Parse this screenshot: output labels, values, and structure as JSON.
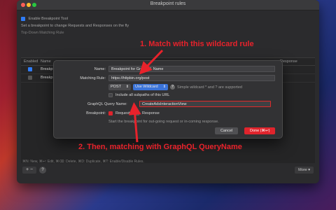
{
  "window": {
    "title": "Breakpoint rules"
  },
  "background": {
    "enable_label": "Enable Breakpoint Tool",
    "description": "Set a breakpoint to change Requests and Responses on the fly",
    "section_label": "Top-Down Matching Rule",
    "columns": {
      "enabled": "Enabled",
      "name": "Name",
      "response": "Response"
    },
    "rows": [
      "Breakp",
      "Breakp"
    ],
    "footer_hint": "⌘N: New, ⌘↩: Edit, ⌘⌫: Delete, ⌘D: Duplicate, ⌘T: Enable/Disable Rules.",
    "more_label": "More"
  },
  "sheet": {
    "name_label": "Name:",
    "name_value": "Breakpoint for GraphQL Name",
    "matching_rule_label": "Matching Rule:",
    "matching_rule_value": "https://httpbin.org/post",
    "method_value": "POST",
    "wildcard_value": "Use Wildcard",
    "wildcard_hint": "Simple wildcard * and ? are supported",
    "include_subpaths_label": "Include all subpaths of this URL",
    "graphql_label": "GraphQL Query Name:",
    "graphql_value": "CreateAdsInteractionView",
    "breakpoint_label": "Breakpoint:",
    "request_label": "Request",
    "response_label": "Response",
    "breakpoint_hint": "Start the breakpoint for out-going request or in-coming response.",
    "cancel_label": "Cancel",
    "done_label": "Done (⌘↩)"
  },
  "annotations": {
    "first": "1. Match with this wildcard rule",
    "second": "2. Then, matching with GraphQL QueryName",
    "color": "#e8222b"
  }
}
